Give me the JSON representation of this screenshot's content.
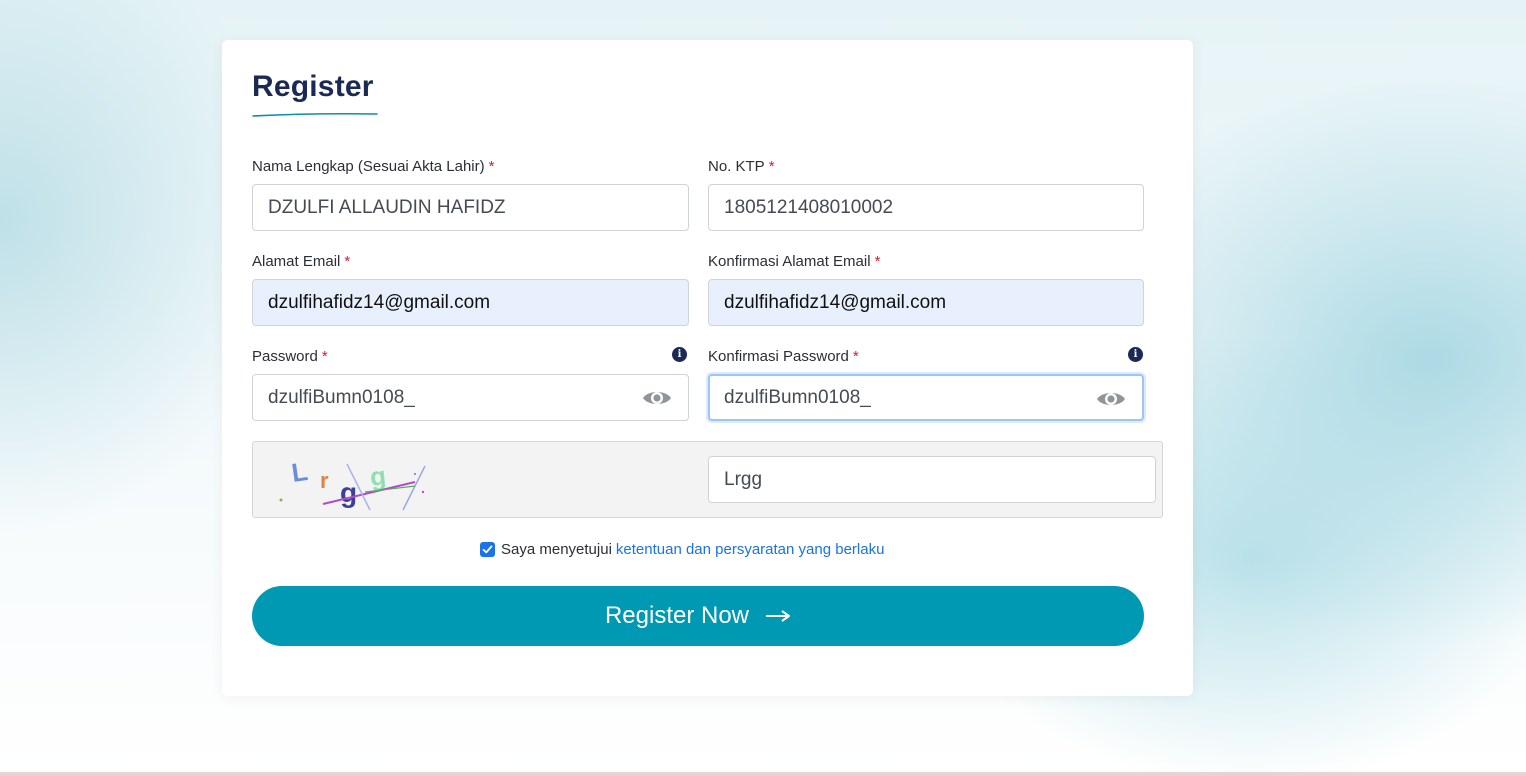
{
  "page": {
    "title": "Register"
  },
  "form": {
    "full_name": {
      "label": "Nama Lengkap (Sesuai Akta Lahir)",
      "required": "*",
      "value": "DZULFI ALLAUDIN HAFIDZ"
    },
    "ktp": {
      "label": "No. KTP",
      "required": "*",
      "value": "1805121408010002"
    },
    "email": {
      "label": "Alamat Email",
      "required": "*",
      "value": "dzulfihafidz14@gmail.com"
    },
    "email_confirm": {
      "label": "Konfirmasi Alamat Email",
      "required": "*",
      "value": "dzulfihafidz14@gmail.com"
    },
    "password": {
      "label": "Password",
      "required": "*",
      "value": "dzulfiBumn0108_",
      "info_icon": "i"
    },
    "password_confirm": {
      "label": "Konfirmasi Password",
      "required": "*",
      "value": "dzulfiBumn0108_",
      "info_icon": "i"
    },
    "captcha": {
      "image_text": "Lrgg",
      "value": "Lrgg"
    },
    "agreement": {
      "checked": true,
      "text": "Saya menyetujui",
      "link_text": "ketentuan dan persyaratan yang berlaku"
    },
    "submit": {
      "label": "Register Now",
      "icon": "arrow-right-icon"
    }
  },
  "colors": {
    "primary_button": "#0099b3",
    "title": "#1a2a55",
    "link": "#1a73e8",
    "required": "#d0202a",
    "autofill_bg": "#e8f0fd"
  }
}
